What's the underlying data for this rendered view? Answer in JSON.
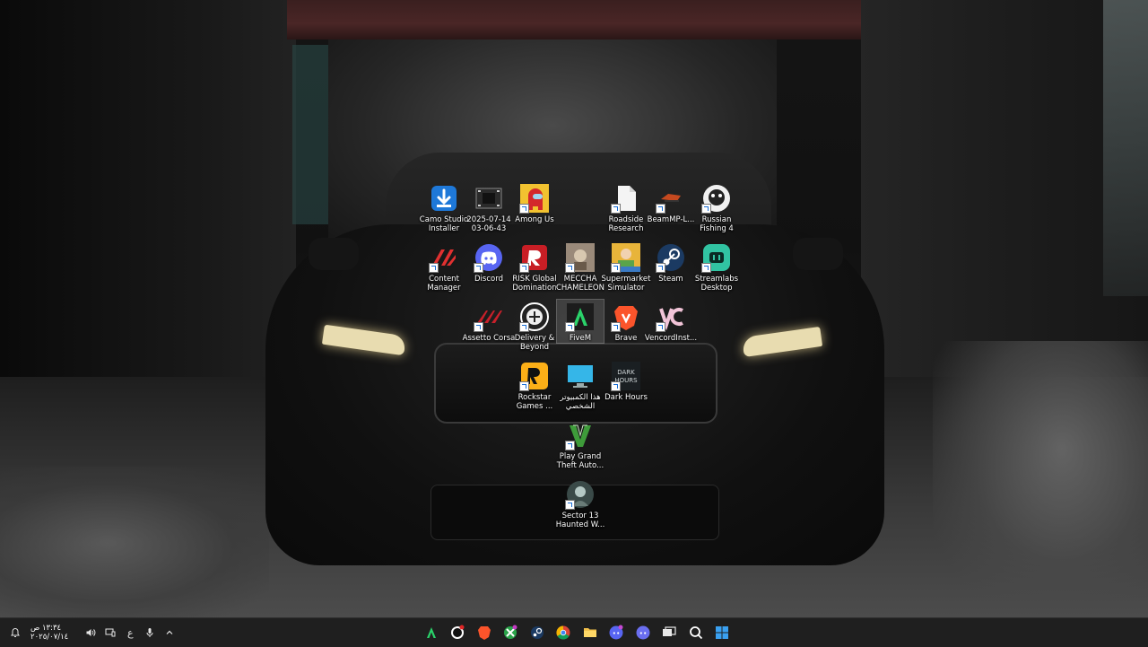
{
  "desktop": {
    "icons": [
      {
        "label": "Camo Studio\nInstaller",
        "icon": "camo-installer-icon",
        "shortcut": false
      },
      {
        "label": "2025-07-14\n03-06-43",
        "icon": "video-file-icon",
        "shortcut": false
      },
      {
        "label": "Among Us",
        "icon": "among-us-icon",
        "shortcut": true
      },
      {
        "label": "Roadside\nResearch",
        "icon": "blank-document-icon",
        "shortcut": true
      },
      {
        "label": "BeamMP-L...",
        "icon": "beammp-icon",
        "shortcut": true
      },
      {
        "label": "Russian\nFishing 4",
        "icon": "russian-fishing-icon",
        "shortcut": true
      },
      {
        "label": "Content\nManager",
        "icon": "content-manager-icon",
        "shortcut": true
      },
      {
        "label": "Discord",
        "icon": "discord-icon",
        "shortcut": true
      },
      {
        "label": "RISK Global\nDomination",
        "icon": "risk-icon",
        "shortcut": true
      },
      {
        "label": "MECCHA\nCHAMELEON",
        "icon": "meccha-chameleon-icon",
        "shortcut": true
      },
      {
        "label": "Supermarket\nSimulator",
        "icon": "supermarket-simulator-icon",
        "shortcut": true
      },
      {
        "label": "Steam",
        "icon": "steam-icon",
        "shortcut": true
      },
      {
        "label": "Streamlabs\nDesktop",
        "icon": "streamlabs-icon",
        "shortcut": true
      },
      {
        "label": "Assetto Corsa",
        "icon": "assetto-corsa-icon",
        "shortcut": true
      },
      {
        "label": "Delivery &\nBeyond",
        "icon": "delivery-beyond-icon",
        "shortcut": true
      },
      {
        "label": "FiveM",
        "icon": "fivem-icon",
        "shortcut": true,
        "selected": true
      },
      {
        "label": "Brave",
        "icon": "brave-icon",
        "shortcut": true
      },
      {
        "label": "VencordInst...",
        "icon": "vencord-icon",
        "shortcut": true
      },
      {
        "label": "Rockstar\nGames ...",
        "icon": "rockstar-launcher-icon",
        "shortcut": true
      },
      {
        "label": "هذا الكمبيوتر\nالشخصي",
        "icon": "this-pc-icon",
        "shortcut": false
      },
      {
        "label": "Dark Hours",
        "icon": "dark-hours-icon",
        "shortcut": true
      },
      {
        "label": "Play Grand\nTheft Auto...",
        "icon": "gta-v-icon",
        "shortcut": true
      },
      {
        "label": "Sector 13\nHaunted W...",
        "icon": "sector-13-icon",
        "shortcut": true
      }
    ]
  },
  "taskbar": {
    "clock_time": "١٣:٣٤ ص",
    "clock_date": "٢٠٢٥/٠٧/١٤",
    "language": "ع",
    "tray": [
      "notification-bell-icon",
      "volume-icon",
      "display-icon",
      "language-indicator",
      "microphone-icon",
      "chevron-up-icon"
    ],
    "apps": [
      "fivem-icon",
      "rockstar-icon",
      "brave-icon",
      "xbox-icon",
      "steam-icon",
      "chrome-icon",
      "file-explorer-icon",
      "discord-icon",
      "discord-alt-icon",
      "task-view-icon",
      "search-icon",
      "start-icon"
    ]
  }
}
